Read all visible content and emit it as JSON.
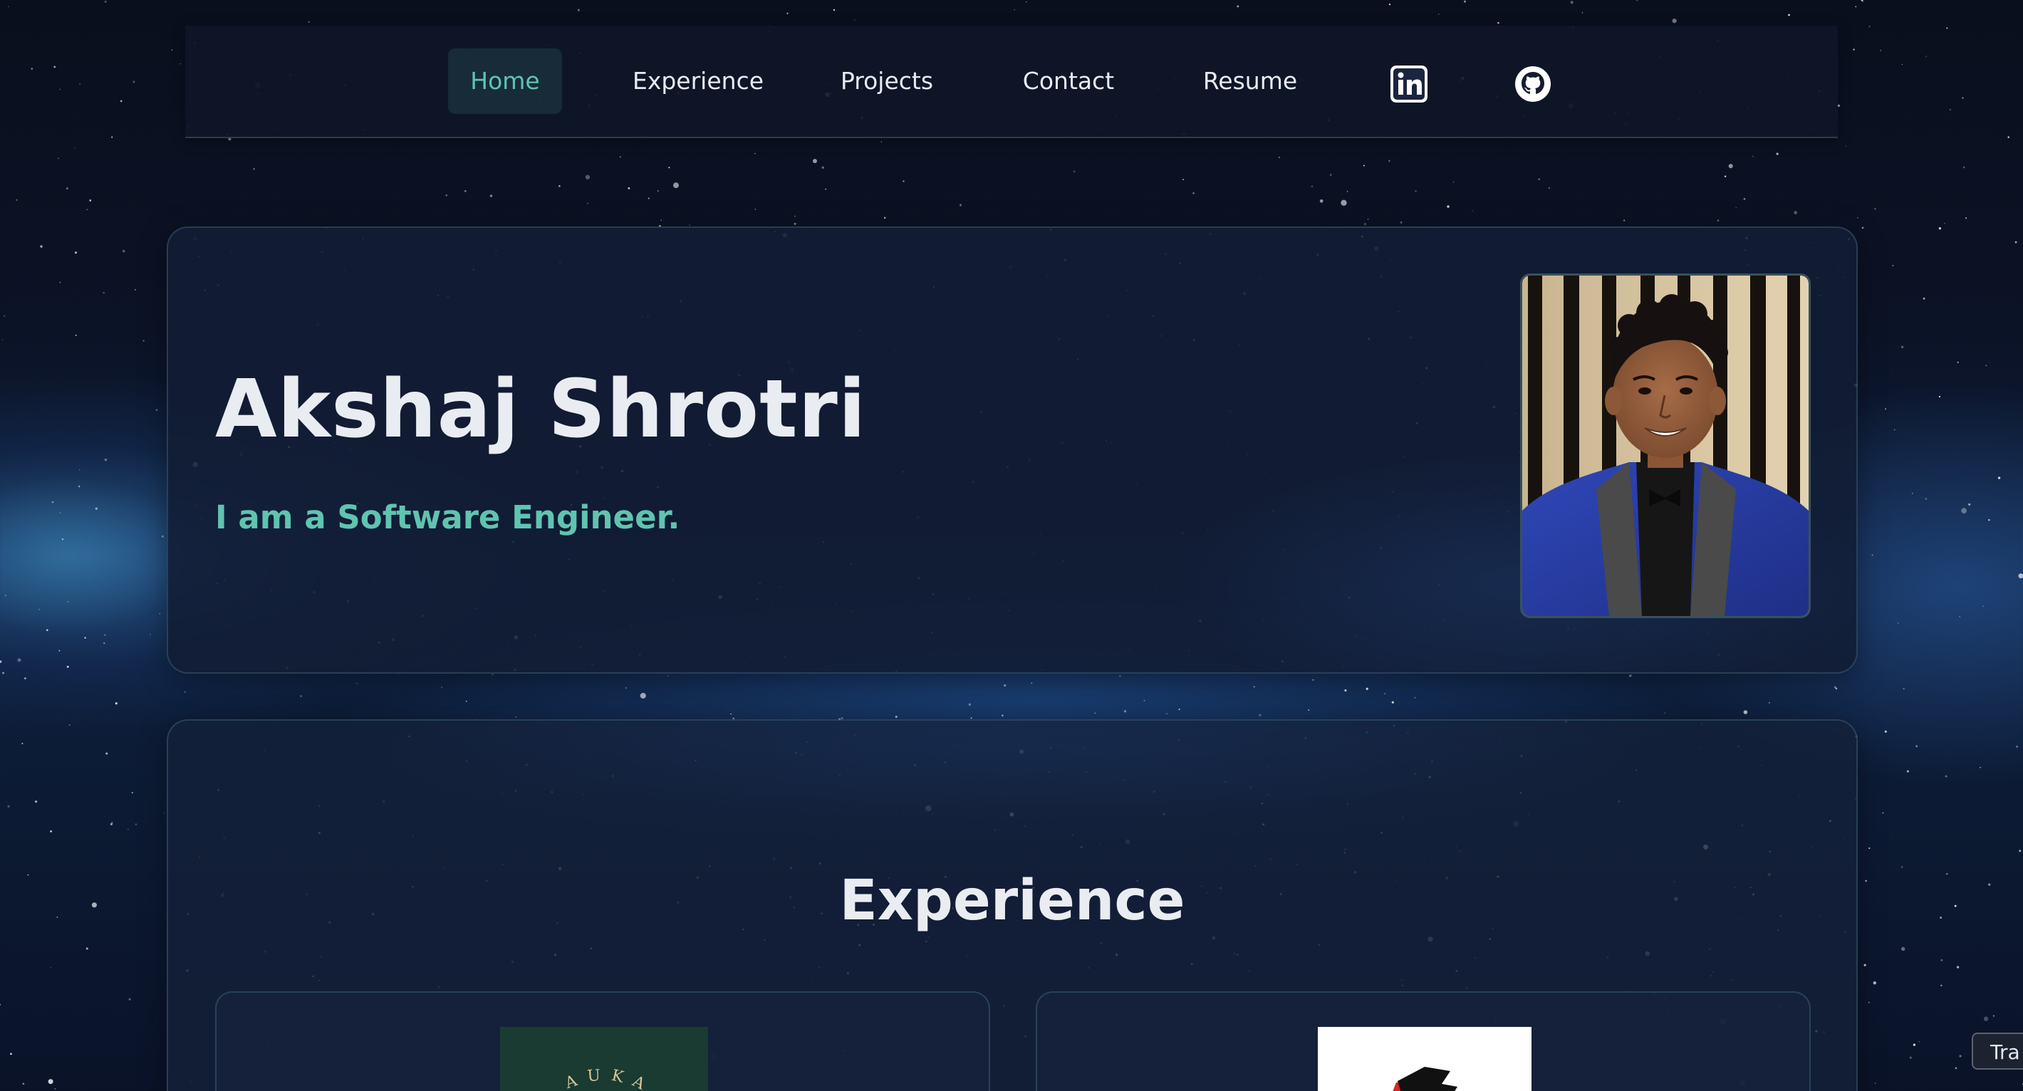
{
  "nav": {
    "items": [
      {
        "label": "Home",
        "active": true
      },
      {
        "label": "Experience",
        "active": false
      },
      {
        "label": "Projects",
        "active": false
      },
      {
        "label": "Contact",
        "active": false
      },
      {
        "label": "Resume",
        "active": false
      }
    ],
    "icons": [
      "linkedin-icon",
      "github-icon"
    ]
  },
  "hero": {
    "name": "Akshaj Shrotri",
    "tagline": "I am a Software Engineer."
  },
  "experience": {
    "title": "Experience",
    "logo_left_text": "AUKA"
  },
  "translate_tab": {
    "label": "Tra"
  },
  "colors": {
    "accent": "#5fc4b0",
    "background": "#0b1326",
    "card": "#141e36",
    "text": "#e9ecf1"
  }
}
